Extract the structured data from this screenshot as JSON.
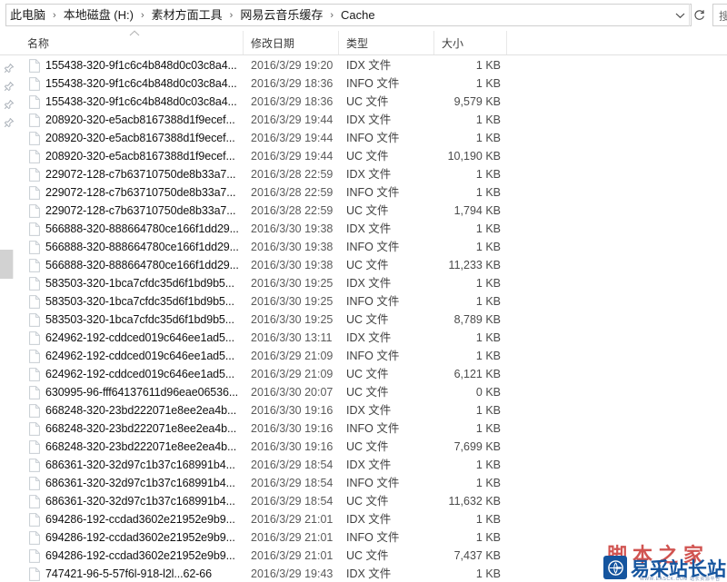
{
  "address_bar": {
    "breadcrumbs": [
      "此电脑",
      "本地磁盘 (H:)",
      "素材方面工具",
      "网易云音乐缓存",
      "Cache"
    ],
    "separator": "›",
    "chevron_icon": "chevron-down-icon",
    "refresh_icon": "refresh-icon",
    "search_placeholder": "搜索",
    "search_value": "搜"
  },
  "columns": {
    "name": "名称",
    "date_modified": "修改日期",
    "type": "类型",
    "size": "大小",
    "sort_icon": "sort-ascending-caret-icon"
  },
  "pins": {
    "icon": "pushpin-icon",
    "count": 4
  },
  "files": [
    {
      "name": "155438-320-9f1c6c4b848d0c03c8a4...",
      "date": "2016/3/29 19:20",
      "type": "IDX 文件",
      "size": "1 KB"
    },
    {
      "name": "155438-320-9f1c6c4b848d0c03c8a4...",
      "date": "2016/3/29 18:36",
      "type": "INFO 文件",
      "size": "1 KB"
    },
    {
      "name": "155438-320-9f1c6c4b848d0c03c8a4...",
      "date": "2016/3/29 18:36",
      "type": "UC 文件",
      "size": "9,579 KB"
    },
    {
      "name": "208920-320-e5acb8167388d1f9ecef...",
      "date": "2016/3/29 19:44",
      "type": "IDX 文件",
      "size": "1 KB"
    },
    {
      "name": "208920-320-e5acb8167388d1f9ecef...",
      "date": "2016/3/29 19:44",
      "type": "INFO 文件",
      "size": "1 KB"
    },
    {
      "name": "208920-320-e5acb8167388d1f9ecef...",
      "date": "2016/3/29 19:44",
      "type": "UC 文件",
      "size": "10,190 KB"
    },
    {
      "name": "229072-128-c7b63710750de8b33a7...",
      "date": "2016/3/28 22:59",
      "type": "IDX 文件",
      "size": "1 KB"
    },
    {
      "name": "229072-128-c7b63710750de8b33a7...",
      "date": "2016/3/28 22:59",
      "type": "INFO 文件",
      "size": "1 KB"
    },
    {
      "name": "229072-128-c7b63710750de8b33a7...",
      "date": "2016/3/28 22:59",
      "type": "UC 文件",
      "size": "1,794 KB"
    },
    {
      "name": "566888-320-888664780ce166f1dd29...",
      "date": "2016/3/30 19:38",
      "type": "IDX 文件",
      "size": "1 KB"
    },
    {
      "name": "566888-320-888664780ce166f1dd29...",
      "date": "2016/3/30 19:38",
      "type": "INFO 文件",
      "size": "1 KB"
    },
    {
      "name": "566888-320-888664780ce166f1dd29...",
      "date": "2016/3/30 19:38",
      "type": "UC 文件",
      "size": "11,233 KB"
    },
    {
      "name": "583503-320-1bca7cfdc35d6f1bd9b5...",
      "date": "2016/3/30 19:25",
      "type": "IDX 文件",
      "size": "1 KB"
    },
    {
      "name": "583503-320-1bca7cfdc35d6f1bd9b5...",
      "date": "2016/3/30 19:25",
      "type": "INFO 文件",
      "size": "1 KB"
    },
    {
      "name": "583503-320-1bca7cfdc35d6f1bd9b5...",
      "date": "2016/3/30 19:25",
      "type": "UC 文件",
      "size": "8,789 KB"
    },
    {
      "name": "624962-192-cddced019c646ee1ad5...",
      "date": "2016/3/30 13:11",
      "type": "IDX 文件",
      "size": "1 KB"
    },
    {
      "name": "624962-192-cddced019c646ee1ad5...",
      "date": "2016/3/29 21:09",
      "type": "INFO 文件",
      "size": "1 KB"
    },
    {
      "name": "624962-192-cddced019c646ee1ad5...",
      "date": "2016/3/29 21:09",
      "type": "UC 文件",
      "size": "6,121 KB"
    },
    {
      "name": "630995-96-fff64137611d96eae06536...",
      "date": "2016/3/30 20:07",
      "type": "UC 文件",
      "size": "0 KB"
    },
    {
      "name": "668248-320-23bd222071e8ee2ea4b...",
      "date": "2016/3/30 19:16",
      "type": "IDX 文件",
      "size": "1 KB"
    },
    {
      "name": "668248-320-23bd222071e8ee2ea4b...",
      "date": "2016/3/30 19:16",
      "type": "INFO 文件",
      "size": "1 KB"
    },
    {
      "name": "668248-320-23bd222071e8ee2ea4b...",
      "date": "2016/3/30 19:16",
      "type": "UC 文件",
      "size": "7,699 KB"
    },
    {
      "name": "686361-320-32d97c1b37c168991b4...",
      "date": "2016/3/29 18:54",
      "type": "IDX 文件",
      "size": "1 KB"
    },
    {
      "name": "686361-320-32d97c1b37c168991b4...",
      "date": "2016/3/29 18:54",
      "type": "INFO 文件",
      "size": "1 KB"
    },
    {
      "name": "686361-320-32d97c1b37c168991b4...",
      "date": "2016/3/29 18:54",
      "type": "UC 文件",
      "size": "11,632 KB"
    },
    {
      "name": "694286-192-ccdad3602e21952e9b9...",
      "date": "2016/3/29 21:01",
      "type": "IDX 文件",
      "size": "1 KB"
    },
    {
      "name": "694286-192-ccdad3602e21952e9b9...",
      "date": "2016/3/29 21:01",
      "type": "INFO 文件",
      "size": "1 KB"
    },
    {
      "name": "694286-192-ccdad3602e21952e9b9...",
      "date": "2016/3/29 21:01",
      "type": "UC 文件",
      "size": "7,437 KB"
    },
    {
      "name": "747421-96-5-57f6l-918-l2l...62-66",
      "date": "2016/3/29 19:43",
      "type": "IDX 文件",
      "size": "1 KB"
    }
  ],
  "watermark": {
    "red_text": "脚本之家",
    "blue_text": "易采站长站",
    "sub_text": "WWW.EASCK.COM  站长资源平台",
    "badge_icon": "globe-logo-icon",
    "brand_color": "#15559f",
    "accent_color": "#c42420"
  }
}
